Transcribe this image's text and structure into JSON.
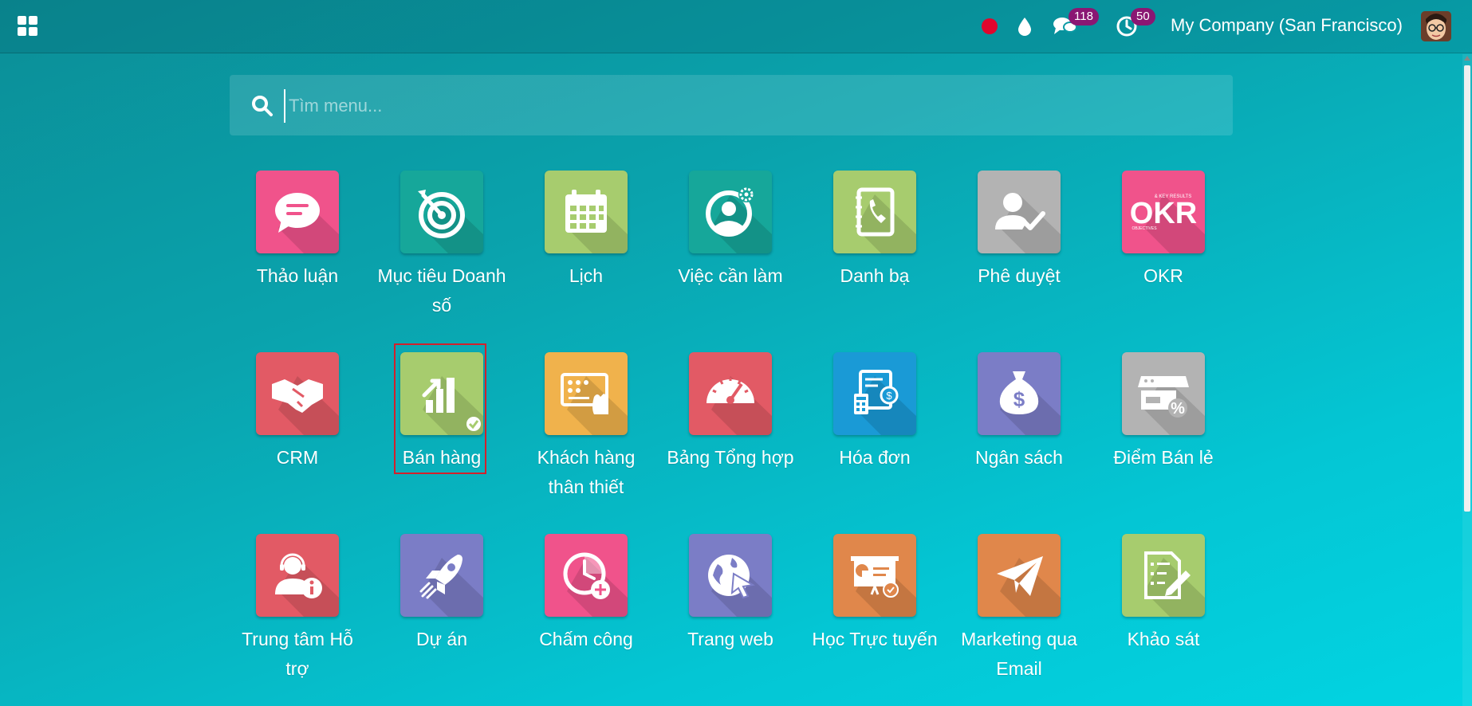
{
  "topbar": {
    "company": "My Company (San Francisco)",
    "chat_count": "118",
    "activity_count": "50"
  },
  "search": {
    "placeholder": "Tìm menu..."
  },
  "apps": [
    {
      "label": "Thảo luận",
      "color": "#f0538b",
      "icon": "chat-bubble-icon"
    },
    {
      "label": "Mục tiêu Doanh số",
      "color": "#16a79a",
      "icon": "target-icon"
    },
    {
      "label": "Lịch",
      "color": "#a7cc6e",
      "icon": "calendar-icon"
    },
    {
      "label": "Việc cần làm",
      "color": "#16a79a",
      "icon": "user-gear-icon"
    },
    {
      "label": "Danh bạ",
      "color": "#a7cc6e",
      "icon": "phonebook-icon"
    },
    {
      "label": "Phê duyệt",
      "color": "#b3b3b3",
      "icon": "user-check-icon"
    },
    {
      "label": "OKR",
      "color": "#f0538b",
      "icon": "okr-icon"
    },
    {
      "label": "CRM",
      "color": "#e25a65",
      "icon": "handshake-icon"
    },
    {
      "label": "Bán hàng",
      "color": "#a7cc6e",
      "icon": "sales-chart-icon"
    },
    {
      "label": "Khách hàng thân thiết",
      "color": "#f0b24c",
      "icon": "loyalty-card-icon"
    },
    {
      "label": "Bảng Tổng hợp",
      "color": "#e25a65",
      "icon": "speedometer-icon"
    },
    {
      "label": "Hóa đơn",
      "color": "#1a9ad6",
      "icon": "invoice-icon"
    },
    {
      "label": "Ngân sách",
      "color": "#7b7dc6",
      "icon": "money-bag-icon"
    },
    {
      "label": "Điểm Bán lẻ",
      "color": "#b3b3b3",
      "icon": "shop-icon"
    },
    {
      "label": "Trung tâm Hỗ trợ",
      "color": "#e25a65",
      "icon": "helpdesk-icon"
    },
    {
      "label": "Dự án",
      "color": "#7b7dc6",
      "icon": "rocket-icon"
    },
    {
      "label": "Chấm công",
      "color": "#f0538b",
      "icon": "timesheet-icon"
    },
    {
      "label": "Trang web",
      "color": "#7b7dc6",
      "icon": "globe-cursor-icon"
    },
    {
      "label": "Học Trực tuyến",
      "color": "#e0874b",
      "icon": "presentation-icon"
    },
    {
      "label": "Marketing qua Email",
      "color": "#e0874b",
      "icon": "paper-plane-icon"
    },
    {
      "label": "Khảo sát",
      "color": "#a7cc6e",
      "icon": "survey-icon"
    }
  ],
  "okr_text": {
    "big": "OKR",
    "small_top": "& KEY RESULTS",
    "small_left": "OBJECTIVES"
  }
}
